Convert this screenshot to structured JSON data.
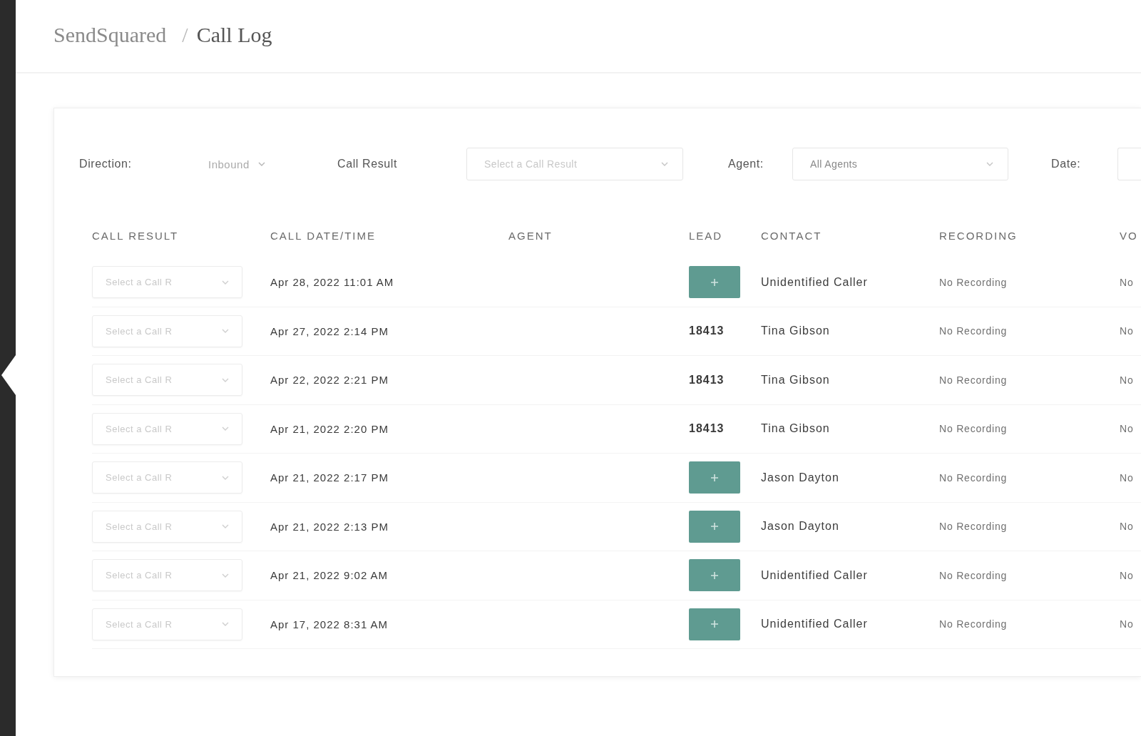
{
  "breadcrumb": {
    "parent": "SendSquared",
    "separator": "/",
    "current": "Call Log"
  },
  "filters": [
    {
      "kind": "plain",
      "label": "Direction:",
      "value": "Inbound"
    },
    {
      "kind": "select",
      "label": "Call Result",
      "placeholder": "Select a Call Result"
    },
    {
      "kind": "select",
      "label": "Agent:",
      "value": "All Agents"
    },
    {
      "kind": "date",
      "label": "Date:"
    }
  ],
  "table": {
    "columns": [
      "CALL RESULT",
      "CALL DATE/TIME",
      "AGENT",
      "LEAD",
      "CONTACT",
      "RECORDING",
      "VO"
    ],
    "rows": [
      {
        "call_result": {
          "placeholder": "Select a Call R"
        },
        "call_datetime": "Apr 28, 2022 11:01 AM",
        "lead": {
          "kind": "button"
        },
        "contact": "Unidentified Caller",
        "recording": "No Recording",
        "column_7": "No"
      },
      {
        "call_result": {
          "placeholder": "Select a Call R"
        },
        "call_datetime": "Apr 27, 2022 2:14 PM",
        "lead": {
          "kind": "id",
          "text": "18413"
        },
        "contact": "Tina Gibson",
        "recording": "No Recording",
        "column_7": "No"
      },
      {
        "call_result": {
          "placeholder": "Select a Call R"
        },
        "call_datetime": "Apr 22, 2022 2:21 PM",
        "lead": {
          "kind": "id",
          "text": "18413"
        },
        "contact": "Tina Gibson",
        "recording": "No Recording",
        "column_7": "No"
      },
      {
        "call_result": {
          "placeholder": "Select a Call R"
        },
        "call_datetime": "Apr 21, 2022 2:20 PM",
        "lead": {
          "kind": "id",
          "text": "18413"
        },
        "contact": "Tina Gibson",
        "recording": "No Recording",
        "column_7": "No"
      },
      {
        "call_result": {
          "placeholder": "Select a Call R"
        },
        "call_datetime": "Apr 21, 2022 2:17 PM",
        "lead": {
          "kind": "button"
        },
        "contact": "Jason Dayton",
        "recording": "No Recording",
        "column_7": "No"
      },
      {
        "call_result": {
          "placeholder": "Select a Call R"
        },
        "call_datetime": "Apr 21, 2022 2:13 PM",
        "lead": {
          "kind": "button"
        },
        "contact": "Jason Dayton",
        "recording": "No Recording",
        "column_7": "No"
      },
      {
        "call_result": {
          "placeholder": "Select a Call R"
        },
        "call_datetime": "Apr 21, 2022 9:02 AM",
        "lead": {
          "kind": "button"
        },
        "contact": "Unidentified Caller",
        "recording": "No Recording",
        "column_7": "No"
      },
      {
        "call_result": {
          "placeholder": "Select a Call R"
        },
        "call_datetime": "Apr 17, 2022 8:31 AM",
        "lead": {
          "kind": "button"
        },
        "contact": "Unidentified Caller",
        "recording": "No Recording",
        "column_7": "No"
      }
    ]
  }
}
